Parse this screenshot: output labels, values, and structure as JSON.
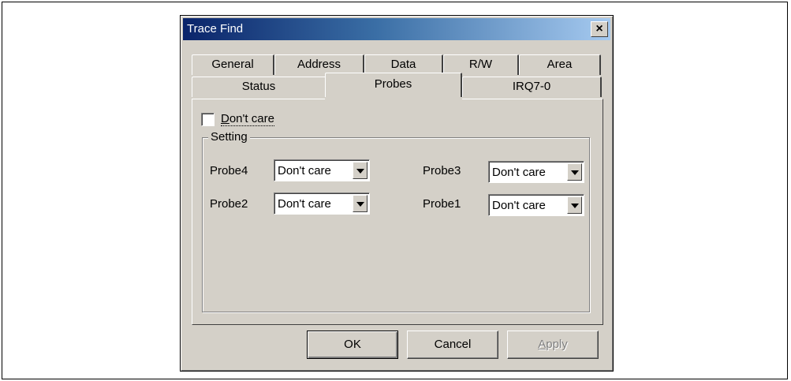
{
  "window": {
    "title": "Trace Find",
    "close_glyph": "×"
  },
  "tabs_row1": [
    "General",
    "Address",
    "Data",
    "R/W",
    "Area"
  ],
  "tabs_row2": [
    "Status",
    "Probes",
    "IRQ7-0"
  ],
  "active_tab": "Probes",
  "dont_care_checkbox": {
    "label_first": "D",
    "label_rest": "on't care",
    "checked": false
  },
  "setting_group": {
    "label": "Setting",
    "probe4": {
      "label": "Probe4",
      "value": "Don't care"
    },
    "probe3": {
      "label": "Probe3",
      "value": "Don't care"
    },
    "probe2": {
      "label": "Probe2",
      "value": "Don't care"
    },
    "probe1": {
      "label": "Probe1",
      "value": "Don't care"
    }
  },
  "buttons": {
    "ok": "OK",
    "cancel": "Cancel",
    "apply_first": "A",
    "apply_rest": "pply"
  }
}
